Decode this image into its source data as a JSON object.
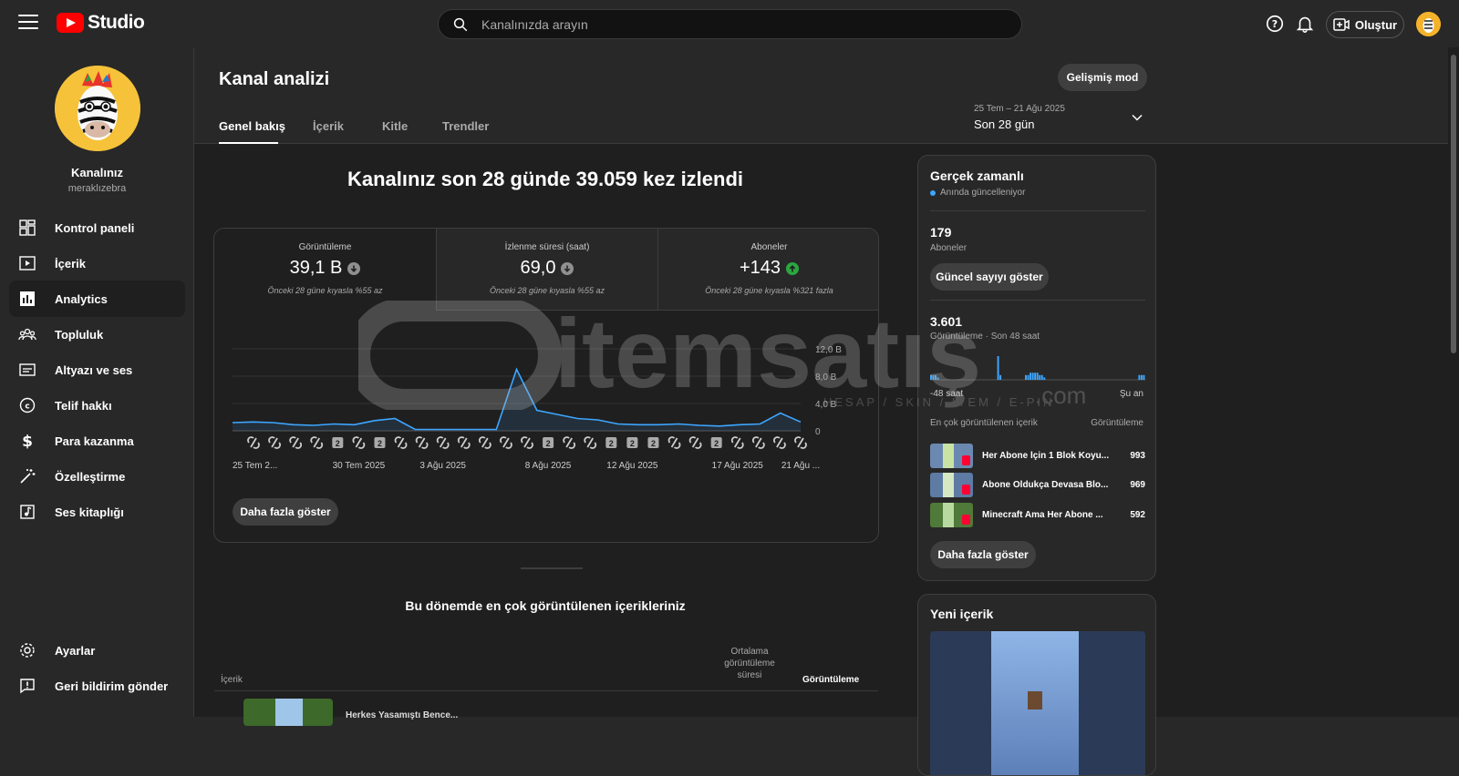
{
  "header": {
    "logo_text": "Studio",
    "search_placeholder": "Kanalınızda arayın",
    "create_label": "Oluştur"
  },
  "sidebar": {
    "channel_name": "Kanalınız",
    "channel_handle": "meraklızebra",
    "items": [
      {
        "label": "Kontrol paneli",
        "icon": "dashboard-icon"
      },
      {
        "label": "İçerik",
        "icon": "content-icon"
      },
      {
        "label": "Analytics",
        "icon": "analytics-icon",
        "active": true
      },
      {
        "label": "Topluluk",
        "icon": "community-icon"
      },
      {
        "label": "Altyazı ve ses",
        "icon": "subtitles-icon"
      },
      {
        "label": "Telif hakkı",
        "icon": "copyright-icon"
      },
      {
        "label": "Para kazanma",
        "icon": "dollar-icon"
      },
      {
        "label": "Özelleştirme",
        "icon": "magic-wand-icon"
      },
      {
        "label": "Ses kitaplığı",
        "icon": "audio-library-icon"
      }
    ],
    "bottom_items": [
      {
        "label": "Ayarlar",
        "icon": "gear-icon"
      },
      {
        "label": "Geri bildirim gönder",
        "icon": "feedback-icon"
      }
    ]
  },
  "page": {
    "title": "Kanal analizi",
    "advanced_mode": "Gelişmiş mod",
    "tabs": [
      "Genel bakış",
      "İçerik",
      "Kitle",
      "Trendler"
    ],
    "active_tab": 0,
    "date_range": "25 Tem – 21 Ağu 2025",
    "date_period": "Son 28 gün"
  },
  "summary": {
    "headline": "Kanalınız son 28 günde 39.059 kez izlendi",
    "metrics": [
      {
        "label": "Görüntüleme",
        "value": "39,1 B",
        "trend": "down",
        "comparison": "Önceki 28 güne kıyasla %55 az"
      },
      {
        "label": "İzlenme süresi (saat)",
        "value": "69,0",
        "trend": "down",
        "comparison": "Önceki 28 güne kıyasla %55 az"
      },
      {
        "label": "Aboneler",
        "value": "+143",
        "trend": "up",
        "comparison": "Önceki 28 güne kıyasla %321 fazla"
      }
    ],
    "show_more": "Daha fazla göster"
  },
  "chart_data": {
    "type": "line",
    "ylabel": "",
    "yticks": [
      "12,0 B",
      "8,0 B",
      "4,0 B",
      "0"
    ],
    "ylim": [
      0,
      12000
    ],
    "xtick_labels": [
      "25 Tem 2...",
      "30 Tem 2025",
      "3 Ağu 2025",
      "8 Ağu 2025",
      "12 Ağu 2025",
      "17 Ağu 2025",
      "21 Ağu ..."
    ],
    "xtick_index": [
      0,
      5,
      9,
      14,
      18,
      23,
      26
    ],
    "values": [
      1200,
      1300,
      1200,
      900,
      800,
      1000,
      900,
      1500,
      1800,
      200,
      200,
      200,
      200,
      200,
      9000,
      3000,
      2400,
      1800,
      1600,
      1000,
      900,
      900,
      1000,
      800,
      700,
      900,
      1000,
      2600,
      1300
    ],
    "markers": [
      "s",
      "s",
      "s",
      "s",
      "2",
      "s",
      "2",
      "s",
      "s",
      "s",
      "s",
      "s",
      "s",
      "s",
      "2",
      "s",
      "s",
      "2",
      "2",
      "2",
      "s",
      "s",
      "2",
      "s",
      "s",
      "s",
      "s"
    ]
  },
  "top_content": {
    "title": "Bu dönemde en çok görüntülenen içerikleriniz",
    "col_content": "İçerik",
    "col_avg_line1": "Ortalama",
    "col_avg_line2": "görüntüleme",
    "col_avg_line3": "süresi",
    "col_views": "Görüntüleme",
    "row1_title": "Herkes Yasamıştı Bence..."
  },
  "realtime": {
    "title": "Gerçek zamanlı",
    "subtitle": "Anında güncelleniyor",
    "subscribers": "179",
    "subscribers_label": "Aboneler",
    "show_count": "Güncel sayıyı göster",
    "views": "3.601",
    "views_label": "Görüntüleme · Son 48 saat",
    "axis_left": "-48 saat",
    "axis_right": "Şu an",
    "top_label": "En çok görüntülenen içerik",
    "top_col": "Görüntüleme",
    "videos": [
      {
        "title": "Her Abone İçin 1 Blok Koyu...",
        "views": "993"
      },
      {
        "title": "Abone Oldukça Devasa Blo...",
        "views": "969"
      },
      {
        "title": "Minecraft Ama Her Abone ...",
        "views": "592"
      }
    ],
    "bars": [
      2,
      2,
      2,
      1,
      0,
      0,
      0,
      0,
      0,
      0,
      0,
      0,
      0,
      0,
      0,
      0,
      0,
      0,
      0,
      0,
      0,
      0,
      0,
      0,
      0,
      0,
      0,
      0,
      0,
      10,
      2,
      0,
      0,
      0,
      0,
      0,
      0,
      0,
      0,
      0,
      0,
      2,
      2,
      3,
      3,
      3,
      3,
      2,
      2,
      1,
      0,
      0,
      0,
      0,
      0,
      0,
      0,
      0,
      0,
      0,
      0,
      0,
      0,
      0,
      0,
      0,
      0,
      0,
      0,
      0,
      0,
      0,
      0,
      0,
      0,
      0,
      0,
      0,
      0,
      0,
      0,
      0,
      0,
      0,
      0,
      0,
      0,
      0,
      0,
      0,
      2,
      2,
      2
    ],
    "show_more": "Daha fazla göster"
  },
  "new_content": {
    "title": "Yeni içerik"
  },
  "watermark": {
    "text": "itemsatış",
    "sub": "HESAP / SKIN / ITEM / E-PIN",
    "domain": ".com"
  },
  "colors": {
    "accent_line": "#3ea6ff",
    "up": "#2ba640",
    "brand": "#ff0000"
  }
}
